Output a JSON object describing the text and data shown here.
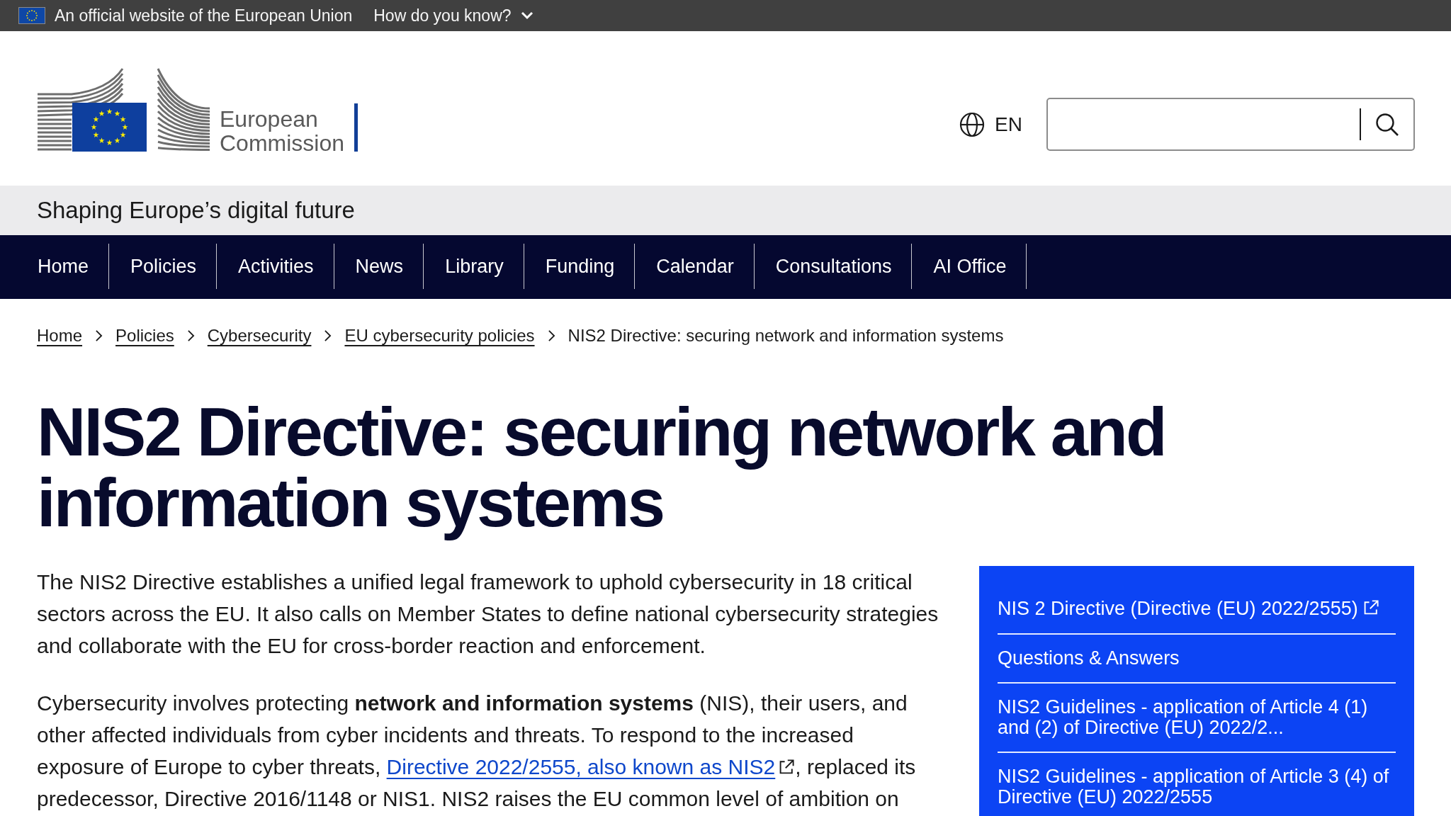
{
  "top_bar": {
    "text": "An official website of the European Union",
    "toggle": "How do you know?"
  },
  "logo": {
    "lines": [
      "European",
      "Commission"
    ]
  },
  "language": {
    "code": "EN"
  },
  "site_name": "Shaping Europe’s digital future",
  "nav": [
    "Home",
    "Policies",
    "Activities",
    "News",
    "Library",
    "Funding",
    "Calendar",
    "Consultations",
    "AI Office"
  ],
  "breadcrumb": [
    {
      "label": "Home",
      "kind": "link"
    },
    {
      "label": "Policies",
      "kind": "link"
    },
    {
      "label": "Cybersecurity",
      "kind": "link"
    },
    {
      "label": "EU cybersecurity policies",
      "kind": "link"
    },
    {
      "label": "NIS2 Directive: securing network and information systems",
      "kind": "current"
    }
  ],
  "page": {
    "title": "NIS2 Directive: securing network and information systems",
    "paragraphs": [
      {
        "segments": [
          {
            "kind": "text",
            "text": "The NIS2 Directive establishes a unified legal framework to uphold cybersecurity in 18 critical sectors across the EU. It also calls on Member States to define national cybersecurity strategies and collaborate with the EU for cross-border reaction and enforcement."
          }
        ]
      },
      {
        "segments": [
          {
            "kind": "text",
            "text": "Cybersecurity involves protecting **network and information systems** (NIS), their users, and other affected individuals from cyber incidents and threats. To respond to the increased exposure of Europe to cyber threats, "
          },
          {
            "kind": "link",
            "text": "Directive 2022/2555, also known as NIS2",
            "external": true
          },
          {
            "kind": "text",
            "text": ", replaced its predecessor, Directive 2016/1148 or NIS1. NIS2 raises the EU common level of ambition on"
          }
        ]
      }
    ]
  },
  "related_links": [
    {
      "label": "NIS 2 Directive (Directive (EU) 2022/2555)",
      "external": true
    },
    {
      "label": "Questions & Answers",
      "external": false
    },
    {
      "label": "NIS2 Guidelines - application of Article 4 (1) and (2) of Directive (EU) 2022/2...",
      "external": false
    },
    {
      "label": "NIS2 Guidelines - application of Article 3 (4) of Directive (EU) 2022/2555",
      "external": false
    }
  ]
}
